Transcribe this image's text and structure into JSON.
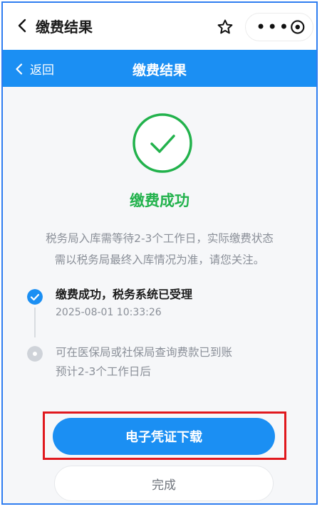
{
  "topbar": {
    "title": "缴费结果",
    "more_label": "•••"
  },
  "navbar": {
    "back_label": "返回",
    "title": "缴费结果"
  },
  "result": {
    "title": "缴费成功",
    "notice_line1": "税务局入库需等待2-3个工作日，实际缴费状态",
    "notice_line2": "需以税务局最终入库情况为准，请您关注。"
  },
  "steps": [
    {
      "title": "缴费成功，税务系统已受理",
      "time": "2025-08-01 10:33:26",
      "status": "done"
    },
    {
      "line1": "可在医保局或社保局查询费款已到账",
      "line2": "预计2-3个工作日后",
      "status": "pending"
    }
  ],
  "buttons": {
    "download_label": "电子凭证下载",
    "done_label": "完成"
  },
  "colors": {
    "accent": "#1b8ff3",
    "success": "#22b24c",
    "highlight": "#e0181e"
  }
}
